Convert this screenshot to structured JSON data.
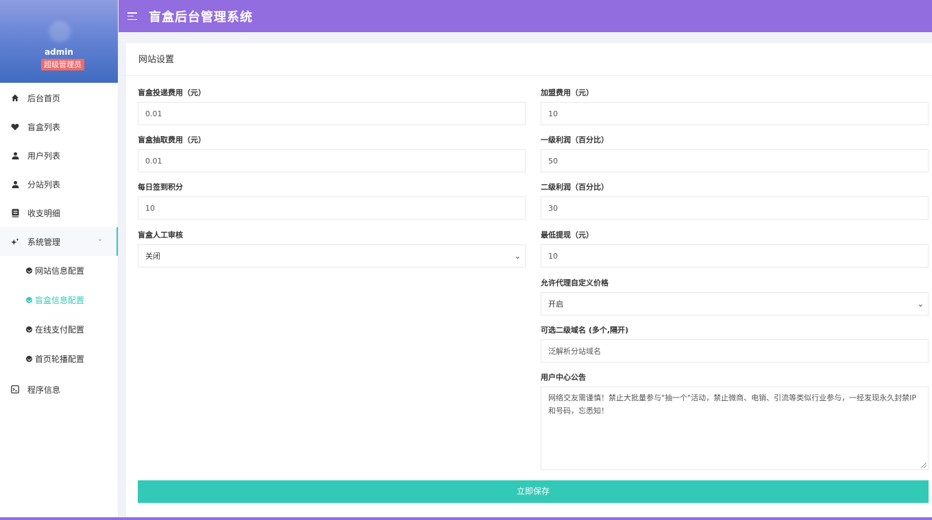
{
  "app": {
    "title": "盲盒后台管理系统"
  },
  "profile": {
    "name": "admin",
    "role": "超级管理员"
  },
  "sidebar": {
    "items": [
      {
        "label": "后台首页",
        "icon": "home-icon"
      },
      {
        "label": "盲盒列表",
        "icon": "heart-icon"
      },
      {
        "label": "用户列表",
        "icon": "user-icon"
      },
      {
        "label": "分站列表",
        "icon": "user-icon"
      },
      {
        "label": "收支明细",
        "icon": "ledger-icon"
      },
      {
        "label": "系统管理",
        "icon": "sparkle-icon",
        "expanded": true
      },
      {
        "label": "程序信息",
        "icon": "terminal-icon"
      }
    ],
    "submenu": [
      {
        "label": "网站信息配置"
      },
      {
        "label": "盲盒信息配置",
        "current": true
      },
      {
        "label": "在线支付配置"
      },
      {
        "label": "首页轮播配置"
      }
    ]
  },
  "card": {
    "title": "网站设置",
    "left": {
      "delivery_fee": {
        "label": "盲盒投递费用（元）",
        "value": "0.01"
      },
      "draw_fee": {
        "label": "盲盒抽取费用（元）",
        "value": "0.01"
      },
      "daily_points": {
        "label": "每日签到积分",
        "value": "10"
      },
      "manual_review": {
        "label": "盲盒人工审核",
        "value": "关闭"
      }
    },
    "right": {
      "join_fee": {
        "label": "加盟费用（元）",
        "value": "10"
      },
      "level1_profit": {
        "label": "一级利润（百分比）",
        "value": "50"
      },
      "level2_profit": {
        "label": "二级利润（百分比）",
        "value": "30"
      },
      "min_withdraw": {
        "label": "最低提现（元）",
        "value": "10"
      },
      "custom_price": {
        "label": "允许代理自定义价格",
        "value": "开启"
      },
      "subdomain": {
        "label": "可选二级域名 (多个,隔开)",
        "value": "泛解析分站域名"
      },
      "notice": {
        "label": "用户中心公告",
        "value": "网络交友需谨慎！禁止大批量参与\"抽一个\"活动，禁止微商、电销、引流等类似行业参与，一经发现永久封禁IP和号码，忘悉知！"
      }
    },
    "save_label": "立即保存"
  }
}
